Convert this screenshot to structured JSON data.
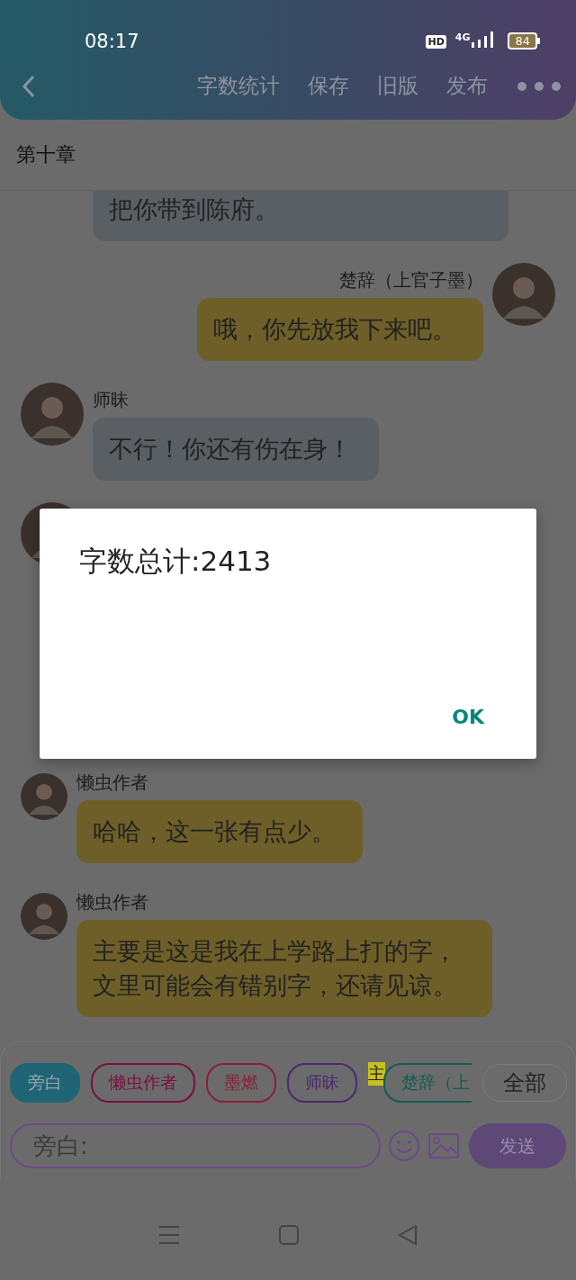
{
  "status_bar": {
    "time": "08:17",
    "hd": "HD",
    "network": "4G",
    "battery": "84"
  },
  "toolbar": {
    "actions": [
      "字数统计",
      "保存",
      "旧版",
      "发布"
    ]
  },
  "chapter": {
    "title": "第十章"
  },
  "messages": [
    {
      "kind": "left",
      "text": "把你带到陈府。",
      "color": "#5a5f64",
      "clipped": true
    },
    {
      "kind": "right",
      "name": "楚辞（上官子墨）",
      "text": "哦，你先放我下来吧。",
      "color": "#6e5f28"
    },
    {
      "kind": "left",
      "name": "师昧",
      "text": "不行！你还有伤在身！",
      "color": "#5a5f64"
    },
    {
      "kind": "covered"
    },
    {
      "kind": "left",
      "name": "懒虫作者",
      "text": "哈哈，这一张有点少。",
      "color": "#6e5f28"
    },
    {
      "kind": "left",
      "name": "懒虫作者",
      "text": "主要是这是我在上学路上打的字，文里可能会有错别字，还请见谅。",
      "color": "#6e5f28"
    }
  ],
  "roles": [
    {
      "kind": "chip",
      "label": "旁白",
      "color": "#1f6575",
      "selected": true
    },
    {
      "kind": "chip",
      "label": "懒虫作者",
      "color": "#7a1040",
      "selected": false
    },
    {
      "kind": "chip",
      "label": "墨燃",
      "color": "#8a2036",
      "selected": false
    },
    {
      "kind": "chip",
      "label": "师昧",
      "color": "#4a2a70",
      "selected": false
    },
    {
      "kind": "mark",
      "label": "主"
    },
    {
      "kind": "chip",
      "label": "楚辞（上",
      "color": "#0e5e50",
      "selected": false
    }
  ],
  "all_button": "全部",
  "composer": {
    "placeholder": "旁白:",
    "send": "发送"
  },
  "dialog": {
    "message": "字数总计:2413",
    "button": "OK"
  }
}
